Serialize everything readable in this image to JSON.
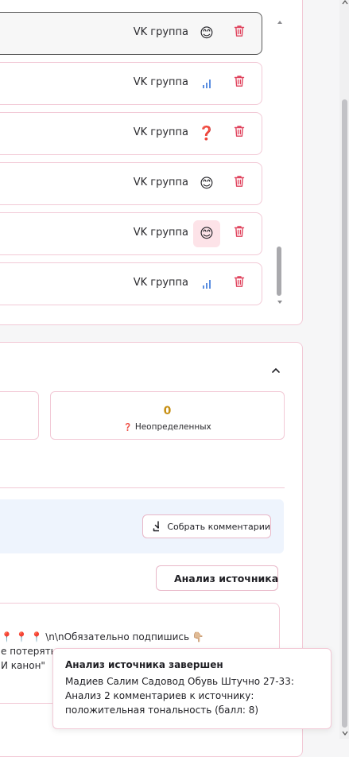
{
  "sources": {
    "items": [
      {
        "label": "VK группа",
        "status": "positive",
        "status_glyph": "😊",
        "selected": true
      },
      {
        "label": "VK группа",
        "status": "stats",
        "status_glyph": "",
        "selected": false
      },
      {
        "label": "VK группа",
        "status": "unknown",
        "status_glyph": "❓",
        "selected": false
      },
      {
        "label": "VK группа",
        "status": "positive",
        "status_glyph": "😊",
        "selected": false
      },
      {
        "label": "VK группа",
        "status": "positive",
        "status_glyph": "😊",
        "selected": false,
        "highlighted": true
      },
      {
        "label": "VK группа",
        "status": "stats",
        "status_glyph": "",
        "selected": false
      }
    ]
  },
  "stats": {
    "undetermined_count": "0",
    "undetermined_icon": "❓",
    "undetermined_label": "Неопределенных"
  },
  "actions": {
    "collect_label": "Собрать комментарии",
    "analyze_label": "Анализ источника"
  },
  "comment": {
    "line1": "📍 📍 📍 \\n\\nОбязательно подпишись 👇🏼",
    "line2": "е потерять",
    "line3": "И канон\""
  },
  "toast": {
    "title": "Анализ источника завершен",
    "message": "Мадиев Салим Садовод Обувь Штучно 27-33: Анализ 2 комментариев к источнику: положительная тональность (балл: 8)"
  },
  "colors": {
    "accent_border": "#f2c9d6",
    "delete_red": "#e0435d",
    "stat_gold": "#c79015",
    "panel_blue": "#eef4fd"
  }
}
